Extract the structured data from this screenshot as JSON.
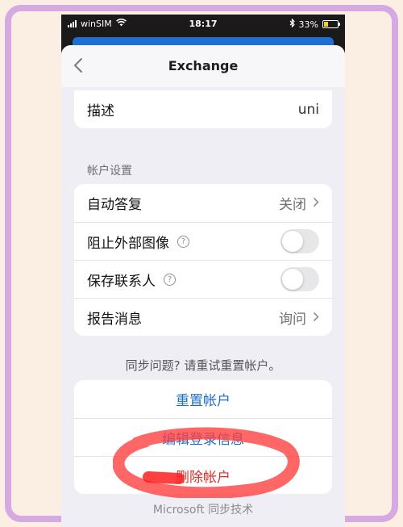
{
  "status": {
    "carrier": "winSIM",
    "time": "18:17",
    "battery": "33%",
    "battery_level": 0.33
  },
  "nav": {
    "title": "Exchange"
  },
  "description": {
    "label": "描述",
    "value": "uni"
  },
  "account_settings": {
    "header": "帐户设置",
    "auto_reply": {
      "label": "自动答复",
      "value": "关闭"
    },
    "block_images": {
      "label": "阻止外部图像",
      "on": false
    },
    "save_contacts": {
      "label": "保存联系人",
      "on": false
    },
    "report_message": {
      "label": "报告消息",
      "value": "询问"
    }
  },
  "sync_note": "同步问题? 请重试重置帐户。",
  "actions": {
    "reset": "重置帐户",
    "edit_login": "编辑登录信息",
    "delete": "删除帐户"
  },
  "footer": "Microsoft 同步技术",
  "colors": {
    "accent": "#1f6fc4",
    "delete": "#d8302b",
    "frame": "#d6a9e3",
    "scribble": "#ff3b3b"
  }
}
